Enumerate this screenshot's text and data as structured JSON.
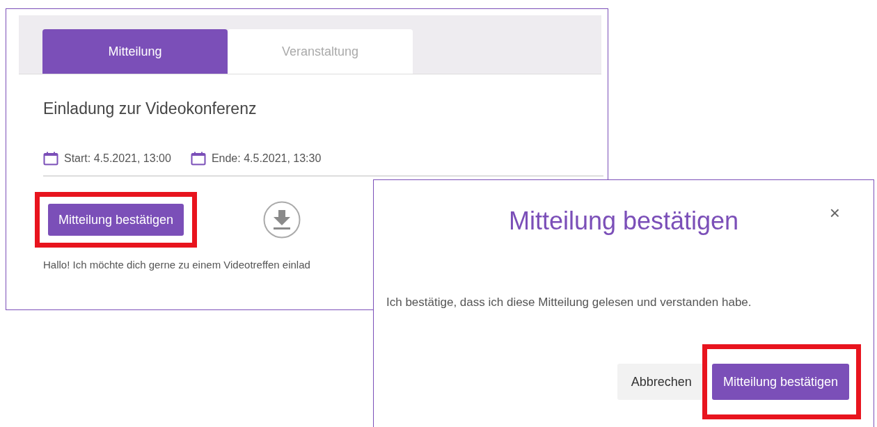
{
  "card": {
    "tabs": [
      {
        "label": "Mitteilung",
        "selected": true
      },
      {
        "label": "Veranstaltung",
        "selected": false
      }
    ],
    "title": "Einladung zur Videokonferenz",
    "dates": [
      {
        "label": "Start: 4.5.2021, 13:00"
      },
      {
        "label": "Ende: 4.5.2021, 13:30"
      }
    ],
    "confirm_button": {
      "label": "Mitteilung bestätigen",
      "highlighted": true
    },
    "intro_text": "Hallo! Ich möchte dich gerne zu einem Videotreffen einlad"
  },
  "dialog": {
    "title": "Mitteilung bestätigen",
    "close": "×",
    "message": "Ich bestätige, dass ich diese Mitteilung gelesen und verstanden habe.",
    "buttons": [
      {
        "label": "Abbrechen",
        "kind": "secondary",
        "highlighted": false
      },
      {
        "label": "Mitteilung bestätigen",
        "kind": "primary",
        "highlighted": true
      }
    ]
  }
}
